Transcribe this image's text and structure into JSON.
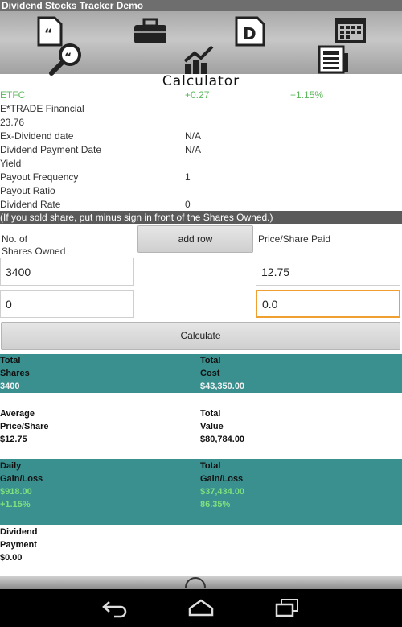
{
  "app": {
    "title": "Dividend Stocks Tracker Demo"
  },
  "toolbar": {
    "icons": [
      "quote-icon",
      "search-icon",
      "briefcase-icon",
      "chart-icon",
      "dividend-icon",
      "calendar-icon",
      "news-icon"
    ]
  },
  "screen": {
    "title": "Calculator"
  },
  "stock": {
    "symbol": "ETFC",
    "change": "+0.27",
    "change_pct": "+1.15%",
    "name": "E*TRADE Financial",
    "price": "23.76",
    "fields": [
      {
        "label": "Ex-Dividend date",
        "value": "N/A"
      },
      {
        "label": "Dividend Payment Date",
        "value": "N/A"
      },
      {
        "label": "Yield",
        "value": ""
      },
      {
        "label": "Payout Frequency",
        "value": "1"
      },
      {
        "label": "Payout Ratio",
        "value": ""
      },
      {
        "label": "Dividend Rate",
        "value": "0"
      }
    ]
  },
  "banner": "(If you sold share, put minus sign in front of the Shares Owned.)",
  "form": {
    "shares_label_1": "No. of",
    "shares_label_2": "Shares Owned",
    "add_row": "add row",
    "price_label": "Price/Share Paid",
    "rows": [
      {
        "shares": "3400",
        "price": "12.75"
      },
      {
        "shares": "0",
        "price": "0.0"
      }
    ],
    "calculate": "Calculate"
  },
  "results": {
    "total_shares_l1": "Total",
    "total_shares_l2": "Shares",
    "total_shares_v": "3400",
    "total_cost_l1": "Total",
    "total_cost_l2": "Cost",
    "total_cost_v": "$43,350.00",
    "avg_l1": "Average",
    "avg_l2": "Price/Share",
    "avg_v": "$12.75",
    "total_value_l1": "Total",
    "total_value_l2": "Value",
    "total_value_v": "$80,784.00",
    "daily_l1": "Daily",
    "daily_l2": "Gain/Loss",
    "daily_v": "$918.00",
    "daily_pct": "+1.15%",
    "total_gl_l1": "Total",
    "total_gl_l2": "Gain/Loss",
    "total_gl_v": "$37,434.00",
    "total_gl_pct": "86.35%",
    "div_l1": "Dividend",
    "div_l2": "Payment",
    "div_v": "$0.00"
  },
  "navbar": {
    "icons": [
      "back-icon",
      "home-icon",
      "recent-apps-icon"
    ]
  }
}
